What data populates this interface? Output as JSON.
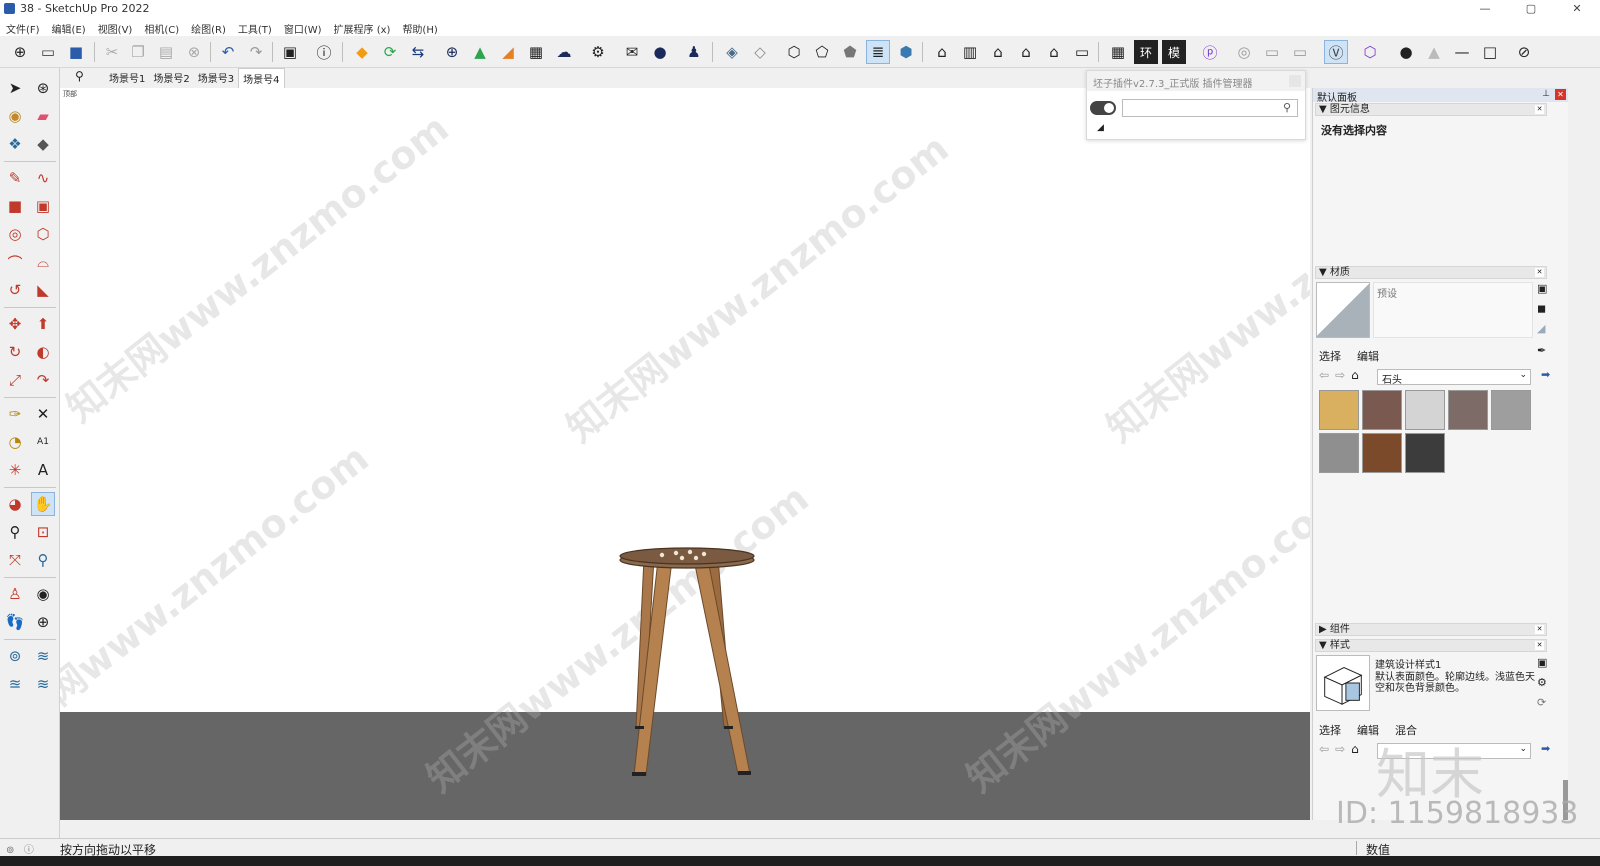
{
  "window": {
    "title": "38 - SketchUp Pro 2022",
    "controls": [
      "—",
      "▢",
      "✕"
    ]
  },
  "menu": [
    "文件(F)",
    "编辑(E)",
    "视图(V)",
    "相机(C)",
    "绘图(R)",
    "工具(T)",
    "窗口(W)",
    "扩展程序 (x)",
    "帮助(H)"
  ],
  "scenes": {
    "search_icon": "search-icon",
    "tabs": [
      "场景号1",
      "场景号2",
      "场景号3",
      "场景号4"
    ],
    "active": "场景号4"
  },
  "viewport": {
    "label": "顶部",
    "watermark": "知末网www.znzmo.com",
    "ground_color": "#666666",
    "background_color": "#ffffff"
  },
  "plugin_manager": {
    "title": "坯子插件v2.7.3_正式版 插件管理器",
    "search_value": "",
    "search_placeholder": ""
  },
  "tray": {
    "title": "默认面板",
    "entity_info": {
      "header": "图元信息",
      "empty_text": "没有选择内容"
    },
    "materials": {
      "header": "材质",
      "current_name": "预设",
      "tabs": [
        "选择",
        "编辑"
      ],
      "library": "石头",
      "swatches": [
        "#d9b05f",
        "#7a5a50",
        "#d4d4d4",
        "#7d6b68",
        "#9e9e9e",
        "#8f8f8f",
        "#7a4a2a",
        "#3c3c3c"
      ]
    },
    "components": {
      "header": "组件"
    },
    "styles": {
      "header": "样式",
      "name": "建筑设计样式1",
      "description": "默认表面颜色。轮廓边线。浅蓝色天空和灰色背景颜色。",
      "tabs": [
        "选择",
        "编辑",
        "混合"
      ]
    }
  },
  "statusbar": {
    "hint": "按方向拖动以平移",
    "vcb_label": "数值"
  },
  "overlay": {
    "brand": "知末",
    "id": "ID: 1159818933"
  }
}
